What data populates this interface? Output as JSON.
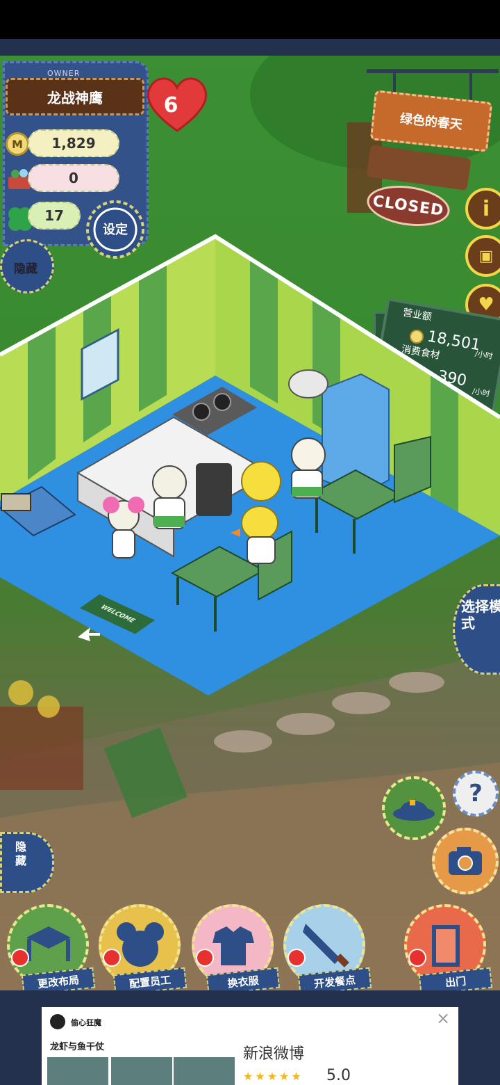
{
  "owner": {
    "label": "OWNER",
    "name": "龙战神鹰",
    "level": "6",
    "coins": "1,829",
    "ingredients": "0",
    "clovers": "17",
    "settings_label": "设定",
    "hide_label": "隐藏"
  },
  "restaurant": {
    "name": "绿色的春天",
    "status": "CLOSED",
    "welcome": "WELCOME"
  },
  "revenue": {
    "sales_label": "营业额",
    "sales_value": "18,501",
    "sales_unit": "/小时",
    "food_label": "消费食材",
    "food_value": "390",
    "food_unit": "/小时"
  },
  "right_menu": {
    "info_icon": "info-icon",
    "book_icon": "book-icon",
    "heart_icon": "heart-icon",
    "select_mode_label": "选择模式",
    "help_label": "?"
  },
  "left_menu": {
    "hide_bottom_label": "隐藏"
  },
  "actions": [
    {
      "label": "更改布局",
      "icon": "table-icon"
    },
    {
      "label": "配置员工",
      "icon": "mouse-head-icon"
    },
    {
      "label": "换衣服",
      "icon": "shirt-icon"
    },
    {
      "label": "开发餐点",
      "icon": "knife-icon"
    },
    {
      "label": "出门",
      "icon": "door-icon"
    }
  ],
  "ad": {
    "user": "偷心狂魔",
    "post_title": "龙虾与鱼干仗",
    "app_name": "新浪微博",
    "stars": "★★★★★",
    "rating": "5.0",
    "close": "×"
  },
  "colors": {
    "denim": "#2d4e86",
    "grass": "#3c8f33",
    "floor": "#2f8fe0",
    "wall_green": "#b8dc54",
    "sign_brown": "#c56a2a"
  }
}
